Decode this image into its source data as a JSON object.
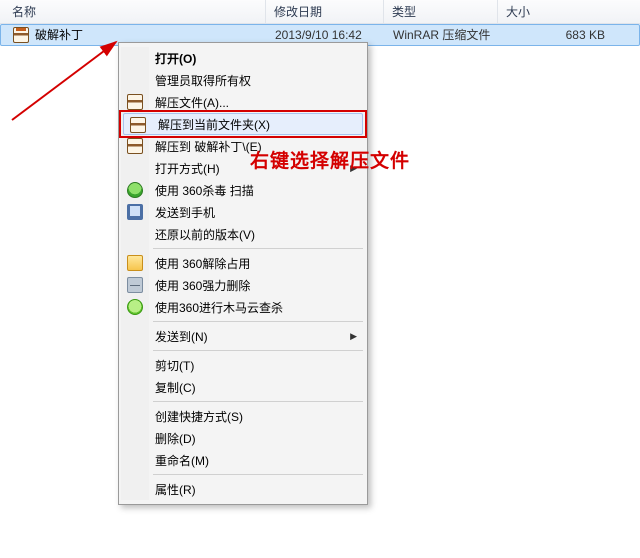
{
  "header": {
    "name": "名称",
    "date": "修改日期",
    "type": "类型",
    "size": "大小"
  },
  "file": {
    "name": "破解补丁",
    "date": "2013/9/10 16:42",
    "type": "WinRAR 压缩文件",
    "size": "683 KB"
  },
  "menu": {
    "open": "打开(O)",
    "admin": "管理员取得所有权",
    "extractA": "解压文件(A)...",
    "extractX": "解压到当前文件夹(X)",
    "extractE": "解压到 破解补丁\\(E)",
    "openWith": "打开方式(H)",
    "scan360": "使用 360杀毒 扫描",
    "sendPhone": "发送到手机",
    "restoreVer": "还原以前的版本(V)",
    "unlock360": "使用 360解除占用",
    "shred360": "使用 360强力删除",
    "cloud360": "使用360进行木马云查杀",
    "sendTo": "发送到(N)",
    "cut": "剪切(T)",
    "copy": "复制(C)",
    "shortcut": "创建快捷方式(S)",
    "delete": "删除(D)",
    "rename": "重命名(M)",
    "props": "属性(R)"
  },
  "annotation": "右键选择解压文件"
}
